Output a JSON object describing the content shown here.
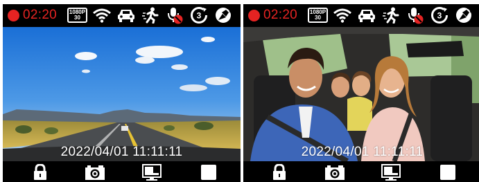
{
  "screens": [
    {
      "id": "road-view",
      "status": {
        "recording_time": "02:20",
        "resolution_top": "1080P",
        "resolution_bottom": "30",
        "icons": [
          "wifi-icon",
          "car-icon",
          "motion-detection-icon",
          "mic-muted-icon",
          "loop-recording-icon",
          "gps-icon"
        ]
      },
      "timestamp": "2022/04/01 11:11:11",
      "toolbar": [
        "lock-icon",
        "camera-icon",
        "display-icon",
        "stop-icon"
      ]
    },
    {
      "id": "cabin-view",
      "status": {
        "recording_time": "02:20",
        "resolution_top": "1080P",
        "resolution_bottom": "30",
        "icons": [
          "wifi-icon",
          "car-icon",
          "motion-detection-icon",
          "mic-muted-icon",
          "loop-recording-icon",
          "gps-icon"
        ]
      },
      "timestamp": "2022/04/01 11:11:11",
      "toolbar": [
        "lock-icon",
        "camera-icon",
        "display-icon",
        "stop-icon"
      ]
    }
  ],
  "colors": {
    "record_red": "#e52322",
    "bar_black": "#000000",
    "icon_white": "#ffffff"
  }
}
